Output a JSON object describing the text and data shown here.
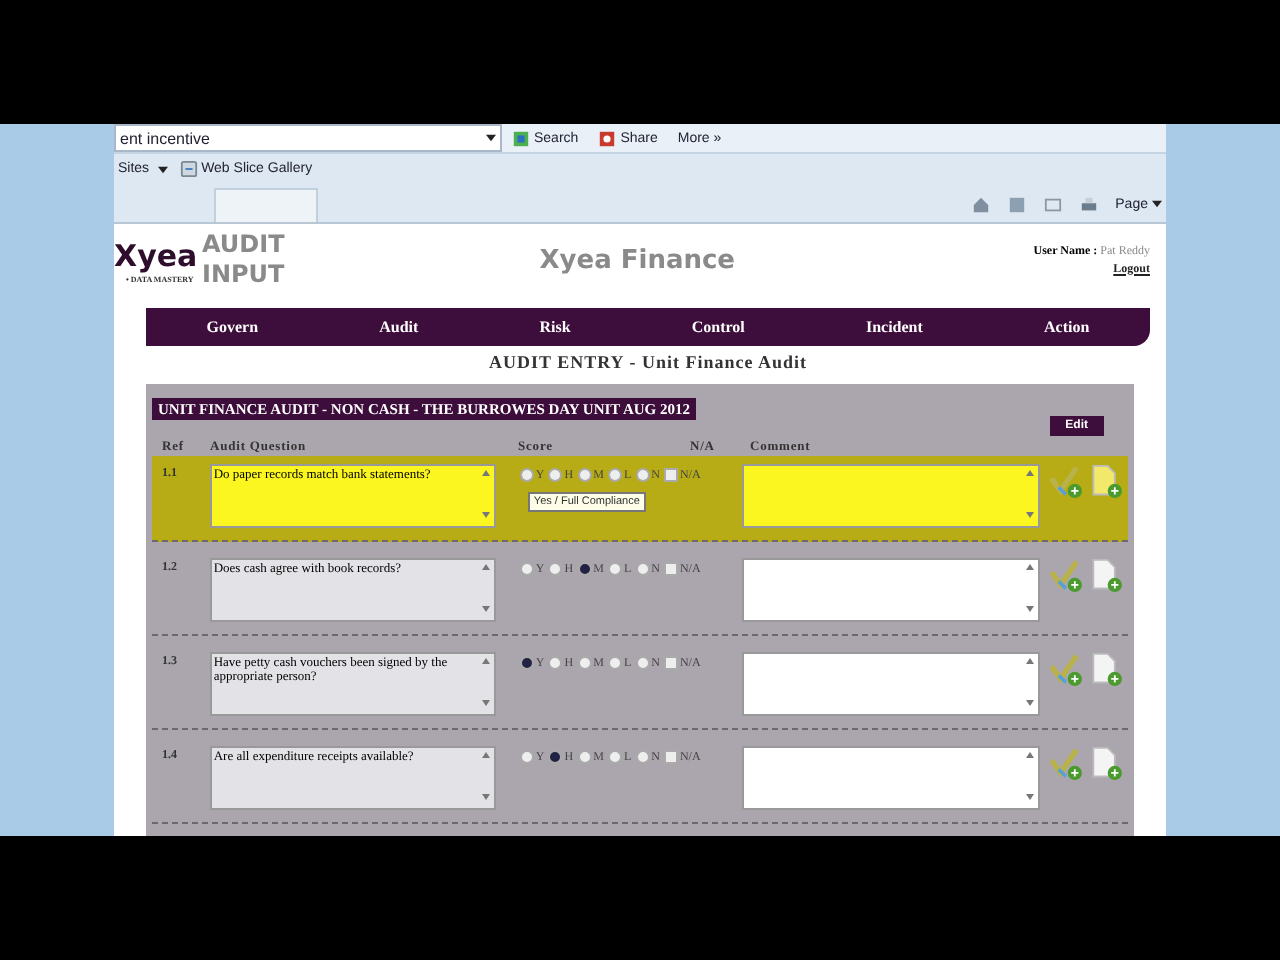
{
  "browser": {
    "address": "ent incentive",
    "toolbar_buttons": [
      {
        "kind": "search",
        "label": "Search"
      },
      {
        "kind": "share",
        "label": "Share"
      },
      {
        "kind": "more",
        "label": "More »"
      }
    ],
    "favorites": [
      "Sites",
      "Web Slice Gallery"
    ],
    "page_menu": "Page"
  },
  "header": {
    "logo": "Xyea",
    "tagline": "• DATA MASTERY",
    "app_title": [
      "AUDIT",
      "INPUT"
    ],
    "company": "Xyea Finance",
    "user_label": "User Name :",
    "user_name": "Pat Reddy",
    "logout": "Logout"
  },
  "nav": [
    "Govern",
    "Audit",
    "Risk",
    "Control",
    "Incident",
    "Action"
  ],
  "page_title": "AUDIT ENTRY - Unit Finance Audit",
  "audit": {
    "title": "UNIT FINANCE AUDIT - NON CASH - THE BURROWES DAY UNIT AUG 2012",
    "edit": "Edit",
    "columns": [
      "Ref",
      "Audit Question",
      "Score",
      "N/A",
      "Comment"
    ],
    "rows": [
      {
        "ref": "1.1",
        "question": "Do paper records match bank statements?",
        "highlighted": true,
        "options": [
          {
            "label": "Y",
            "selected": false
          },
          {
            "label": "H",
            "selected": false
          },
          {
            "label": "M",
            "selected": false
          },
          {
            "label": "L",
            "selected": false
          },
          {
            "label": "N",
            "selected": false
          }
        ],
        "na": {
          "label": "N/A",
          "checked": false
        },
        "tooltip": "Yes / Full Compliance"
      },
      {
        "ref": "1.2",
        "question": "Does cash agree with book records?",
        "highlighted": false,
        "options": [
          {
            "label": "Y",
            "selected": false
          },
          {
            "label": "H",
            "selected": false
          },
          {
            "label": "M",
            "selected": true
          },
          {
            "label": "L",
            "selected": false
          },
          {
            "label": "N",
            "selected": false
          }
        ],
        "na": {
          "label": "N/A",
          "checked": false
        }
      },
      {
        "ref": "1.3",
        "question": "Have petty cash vouchers been signed by the appropriate person?",
        "highlighted": false,
        "options": [
          {
            "label": "Y",
            "selected": true
          },
          {
            "label": "H",
            "selected": false
          },
          {
            "label": "M",
            "selected": false
          },
          {
            "label": "L",
            "selected": false
          },
          {
            "label": "N",
            "selected": false
          }
        ],
        "na": {
          "label": "N/A",
          "checked": false
        }
      },
      {
        "ref": "1.4",
        "question": "Are all expenditure receipts available?",
        "highlighted": false,
        "options": [
          {
            "label": "Y",
            "selected": false
          },
          {
            "label": "H",
            "selected": true
          },
          {
            "label": "M",
            "selected": false
          },
          {
            "label": "L",
            "selected": false
          },
          {
            "label": "N",
            "selected": false
          }
        ],
        "na": {
          "label": "N/A",
          "checked": false
        }
      }
    ]
  }
}
